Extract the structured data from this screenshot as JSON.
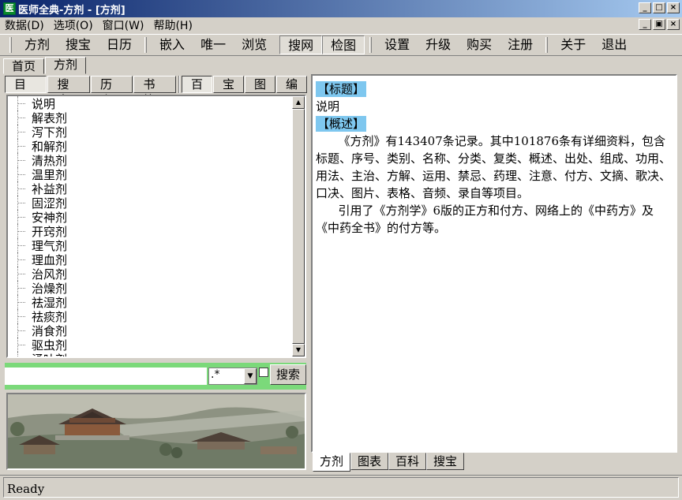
{
  "window": {
    "app_icon": "医",
    "title": "医师全典-方剂 - [方剂]",
    "minimize_glyph": "_",
    "maximize_glyph": "□",
    "close_glyph": "×",
    "restore_glyph": "▣"
  },
  "menubar": {
    "items": [
      "数据(D)",
      "选项(O)",
      "窗口(W)",
      "帮助(H)"
    ]
  },
  "toolbar": {
    "group1": [
      "方剂",
      "搜宝",
      "日历"
    ],
    "group2": [
      "嵌入",
      "唯一",
      "浏览"
    ],
    "group3": [
      "搜网",
      "检图"
    ],
    "group4": [
      "设置",
      "升级",
      "购买",
      "注册"
    ],
    "group5": [
      "关于",
      "退出"
    ]
  },
  "main_tabs": [
    "首页",
    "方剂"
  ],
  "left_tabs": {
    "group1": [
      "目录",
      "搜索",
      "历史",
      "书签"
    ],
    "group2": [
      "百",
      "宝",
      "图",
      "编"
    ]
  },
  "tree": {
    "items": [
      "说明",
      "解表剂",
      "泻下剂",
      "和解剂",
      "清热剂",
      "温里剂",
      "补益剂",
      "固涩剂",
      "安神剂",
      "开窍剂",
      "理气剂",
      "理血剂",
      "治风剂",
      "治燥剂",
      "祛湿剂",
      "祛痰剂",
      "消食剂",
      "驱虫剂",
      "涌吐剂"
    ]
  },
  "search": {
    "value": "",
    "regex": ".*",
    "button": "搜索"
  },
  "content": {
    "heading1": "【标题】",
    "title_text": "说明",
    "heading2": "【概述】",
    "para1": "《方剂》有143407条记录。其中101876条有详细资料，包含标题、序号、类别、名称、分类、复类、概述、出处、组成、功用、用法、主治、方解、运用、禁忌、药理、注意、付方、文摘、歌决、口决、图片、表格、音频、录自等项目。",
    "para2": "引用了《方剂学》6版的正方和付方、网络上的《中药方》及《中药全书》的付方等。"
  },
  "bottom_tabs": [
    "方剂",
    "图表",
    "百科",
    "搜宝"
  ],
  "status": {
    "text": "Ready"
  }
}
